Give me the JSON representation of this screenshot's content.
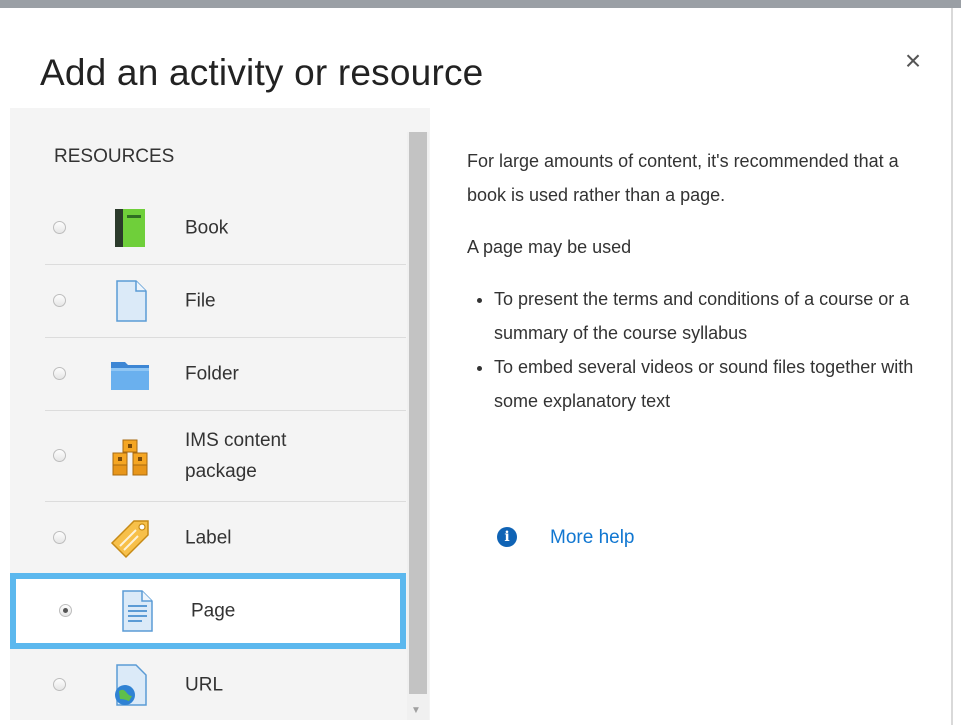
{
  "dialog": {
    "title": "Add an activity or resource",
    "close_glyph": "×"
  },
  "resources": {
    "heading": "RESOURCES",
    "items": [
      {
        "label": "Book",
        "icon": "book-icon",
        "selected": false
      },
      {
        "label": "File",
        "icon": "file-icon",
        "selected": false
      },
      {
        "label": "Folder",
        "icon": "folder-icon",
        "selected": false
      },
      {
        "label": "IMS content package",
        "icon": "ims-package-icon",
        "selected": false
      },
      {
        "label": "Label",
        "icon": "label-tag-icon",
        "selected": false
      },
      {
        "label": "Page",
        "icon": "page-icon",
        "selected": true
      },
      {
        "label": "URL",
        "icon": "url-globe-icon",
        "selected": false
      }
    ]
  },
  "help": {
    "intro": "For large amounts of content, it's recommended that a book is used rather than a page.",
    "usage_heading": "A page may be used",
    "bullets": [
      "To present the terms and conditions of a course or a summary of the course syllabus",
      "To embed several videos or sound files together with some explanatory text"
    ],
    "more_help_label": "More help",
    "info_glyph": "i"
  },
  "colors": {
    "selection_border": "#5cb8ee",
    "link": "#1177d1",
    "info_icon": "#0f63b5"
  }
}
